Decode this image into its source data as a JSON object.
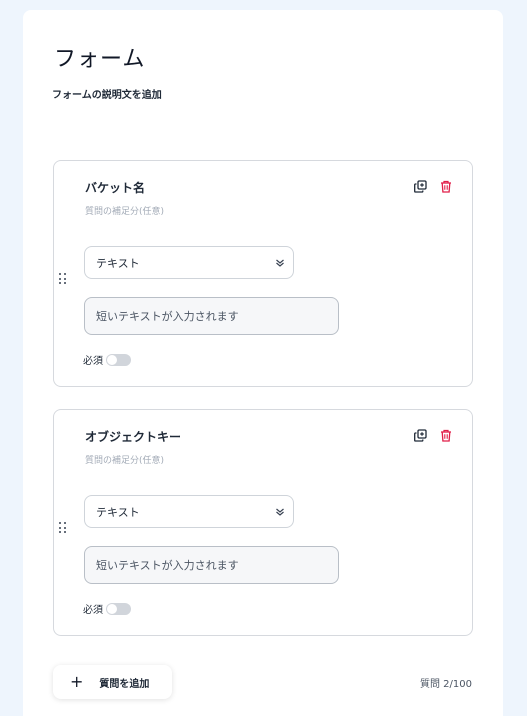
{
  "form": {
    "title": "フォーム",
    "description": "フォームの説明文を追加"
  },
  "questions": [
    {
      "title": "バケット名",
      "hint": "質問の補足分(任意)",
      "type": "テキスト",
      "placeholder": "短いテキストが入力されます",
      "required_label": "必須",
      "required": false
    },
    {
      "title": "オブジェクトキー",
      "hint": "質問の補足分(任意)",
      "type": "テキスト",
      "placeholder": "短いテキストが入力されます",
      "required_label": "必須",
      "required": false
    }
  ],
  "footer": {
    "add_label": "質問を追加",
    "count": "質問 2/100"
  },
  "icons": {
    "copy": "copy-icon",
    "delete": "trash-icon",
    "drag": "drag-handle-icon",
    "chevron": "chevron-down-icon",
    "add": "plus-icon"
  },
  "colors": {
    "background": "#eef5fd",
    "delete": "#e11d48",
    "toggle_off": "#d1d5db"
  }
}
